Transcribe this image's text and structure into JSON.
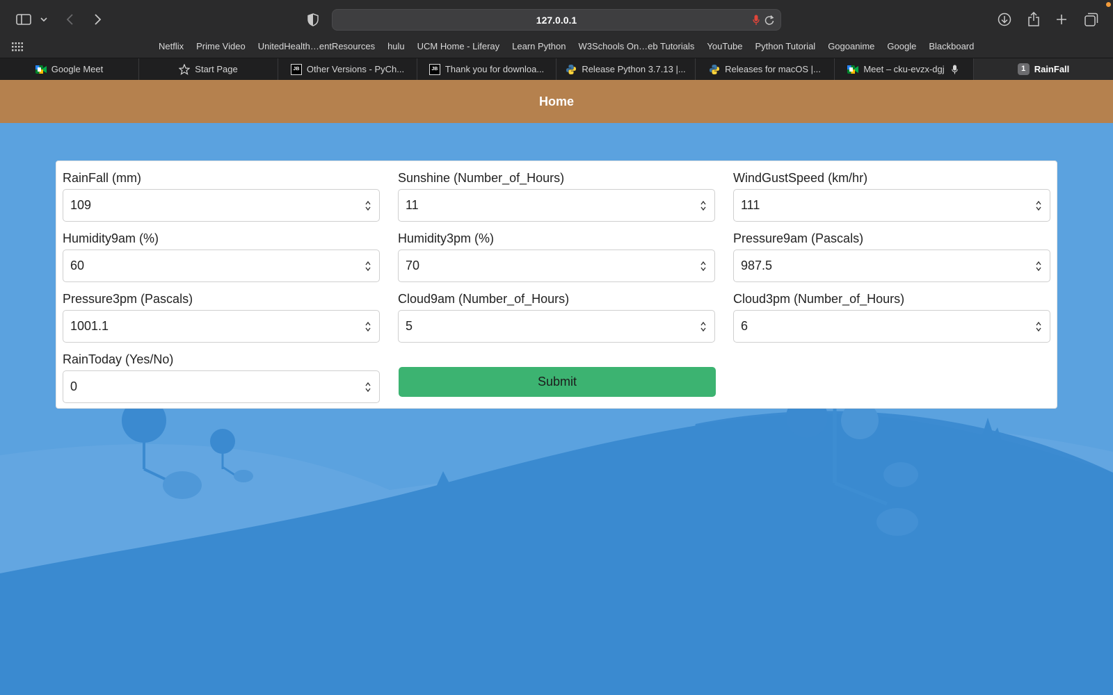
{
  "browser": {
    "url": "127.0.0.1",
    "icons": {
      "sidebar": "sidebar-icon",
      "sidebar_menu": "chevron-down-icon",
      "back": "chevron-left-icon",
      "forward": "chevron-right-icon",
      "privacy": "shield-icon",
      "mic": "microphone-icon",
      "reload": "reload-icon",
      "downloads": "download-icon",
      "share": "share-icon",
      "new_tab": "plus-icon",
      "tab_overview": "tab-overview-icon",
      "favorites_grid": "grid-icon"
    },
    "favorites": [
      "Netflix",
      "Prime Video",
      "UnitedHealth…entResources",
      "hulu",
      "UCM Home - Liferay",
      "Learn Python",
      "W3Schools On…eb Tutorials",
      "YouTube",
      "Python Tutorial",
      "Gogoanime",
      "Google",
      "Blackboard"
    ],
    "tabs": [
      {
        "title": "Google Meet",
        "icon": "google-meet-icon"
      },
      {
        "title": "Start Page",
        "icon": "star-icon"
      },
      {
        "title": "Other Versions - PyCh...",
        "icon": "jetbrains-icon"
      },
      {
        "title": "Thank you for downloa...",
        "icon": "jetbrains-icon"
      },
      {
        "title": "Release Python 3.7.13 |...",
        "icon": "python-icon"
      },
      {
        "title": "Releases for macOS |...",
        "icon": "python-icon"
      },
      {
        "title": "Meet – cku-evzx-dgj",
        "icon": "google-meet-icon"
      },
      {
        "title": "RainFall",
        "badge": "1",
        "active": true
      }
    ],
    "jb_text": "JB"
  },
  "page": {
    "header_title": "Home",
    "fields": [
      {
        "label": "RainFall (mm)",
        "value": "109"
      },
      {
        "label": "Sunshine (Number_of_Hours)",
        "value": "11"
      },
      {
        "label": "WindGustSpeed (km/hr)",
        "value": "111"
      },
      {
        "label": "Humidity9am (%)",
        "value": "60"
      },
      {
        "label": "Humidity3pm (%)",
        "value": "70"
      },
      {
        "label": "Pressure9am (Pascals)",
        "value": "987.5"
      },
      {
        "label": "Pressure3pm (Pascals)",
        "value": "1001.1"
      },
      {
        "label": "Cloud9am (Number_of_Hours)",
        "value": "5"
      },
      {
        "label": "Cloud3pm (Number_of_Hours)",
        "value": "6"
      },
      {
        "label": "RainToday (Yes/No)",
        "value": "0"
      }
    ],
    "submit_label": "Submit",
    "colors": {
      "header": "#b5814e",
      "submit": "#3cb371",
      "background": "#3a8bd0"
    }
  }
}
